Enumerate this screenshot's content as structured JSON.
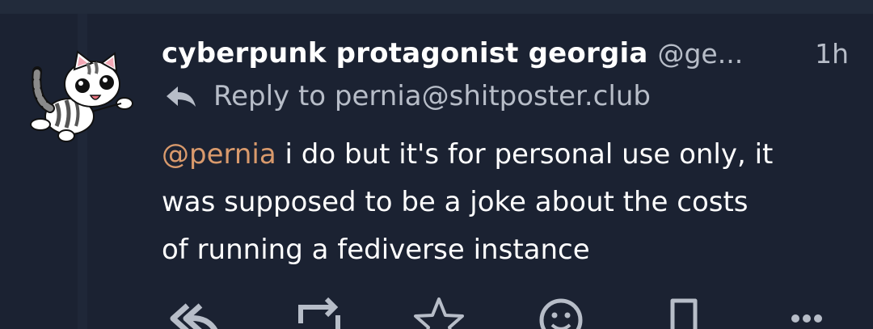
{
  "post": {
    "display_name": "cyberpunk protagonist georgia",
    "handle": "@ge...",
    "timestamp": "1h",
    "reply_to_label": "Reply to pernia@shitposter.club",
    "mention": "@pernia",
    "body_line1": " i do but it's for personal use only, it",
    "body_line2": "was supposed to be a joke about the costs",
    "body_line3": "of running a fediverse instance"
  },
  "colors": {
    "background": "#1b2232",
    "text": "#ffffff",
    "muted": "#b7bdc8",
    "mention": "#d99a6c"
  },
  "icons": {
    "reply": "reply-icon",
    "reply_all": "reply-all-icon",
    "repeat": "repeat-icon",
    "favorite": "star-icon",
    "react": "emoji-icon",
    "bookmark": "bookmark-icon",
    "more": "more-icon"
  }
}
